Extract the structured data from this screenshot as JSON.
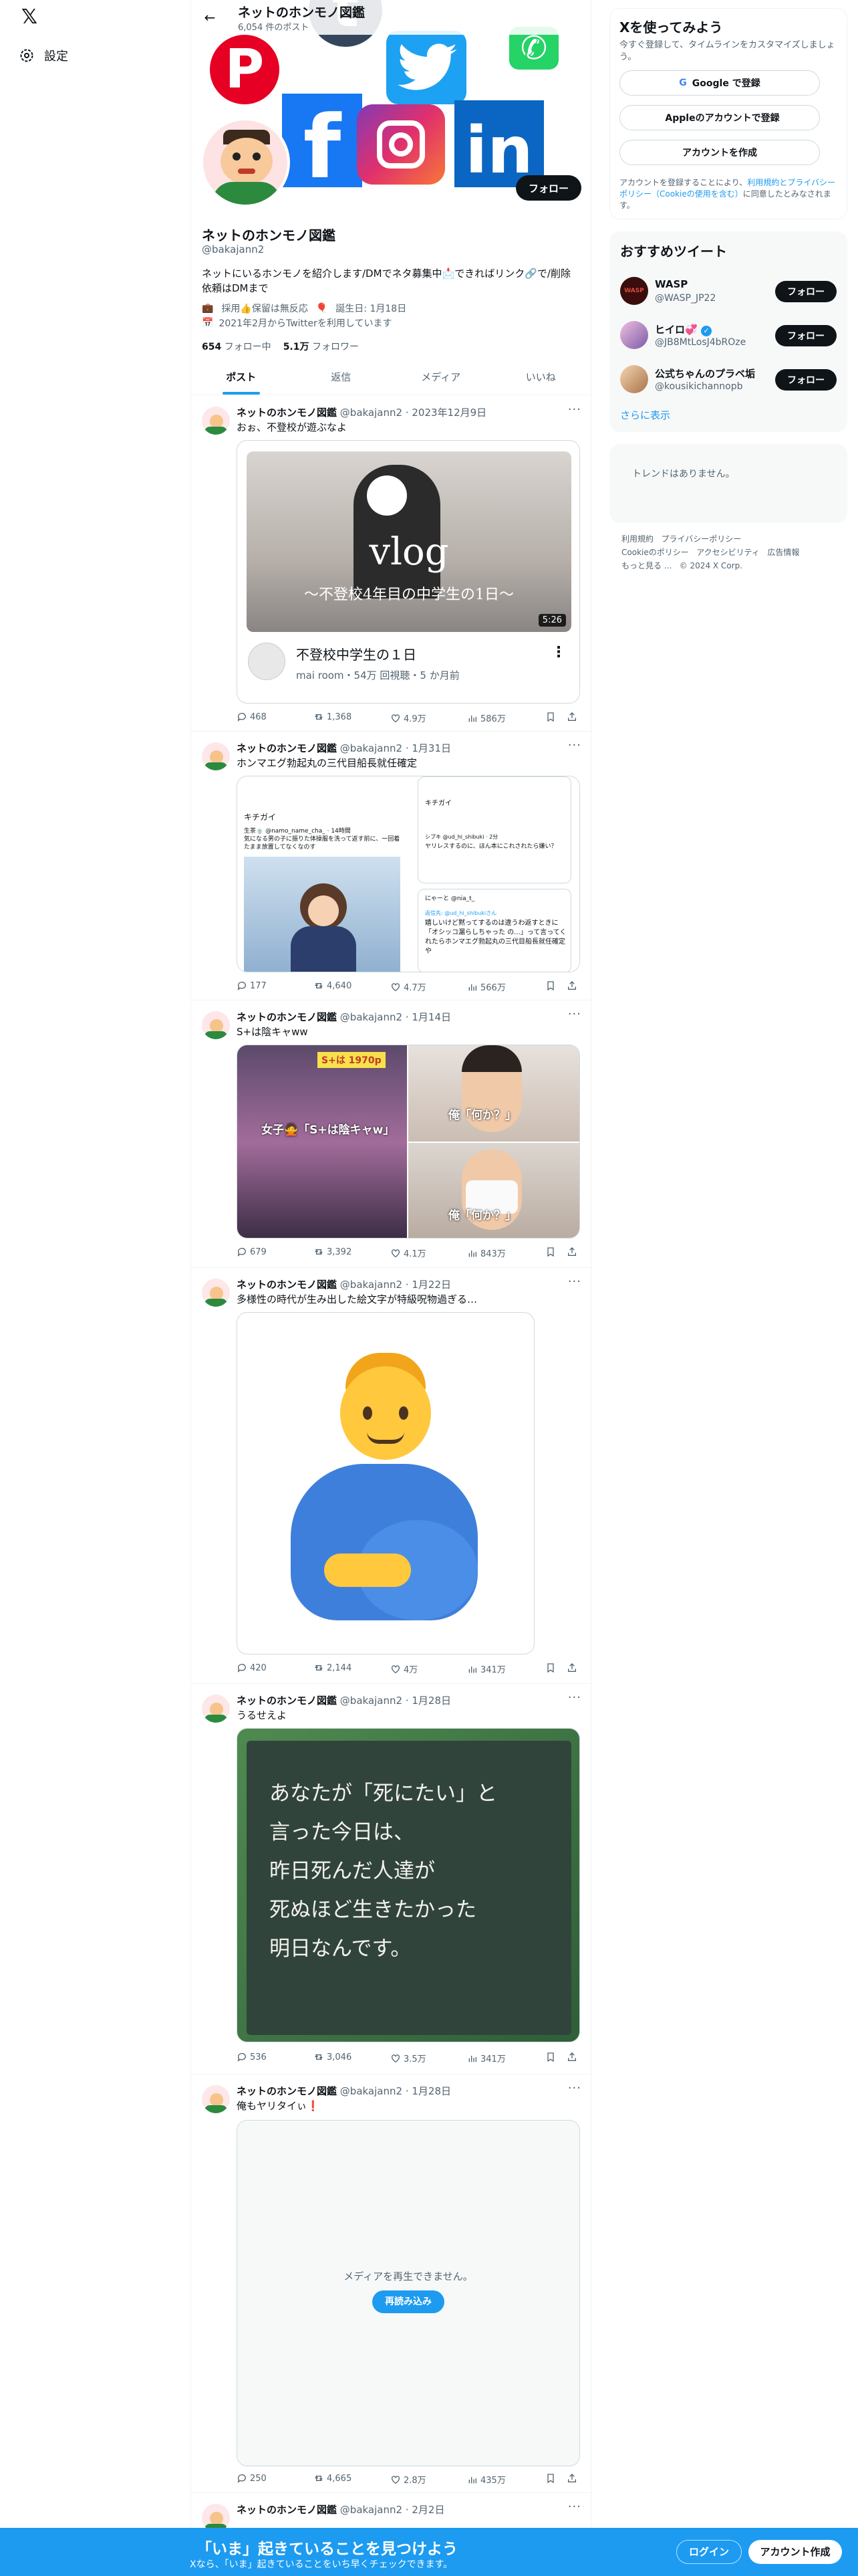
{
  "nav": {
    "settings_label": "設定"
  },
  "header": {
    "title": "ネットのホンモノ図鑑",
    "post_count": "6,054 件のポスト"
  },
  "profile": {
    "name": "ネットのホンモノ図鑑",
    "handle": "@bakajann2",
    "follow_label": "フォロー",
    "bio": "ネットにいるホンモノを紹介します/DMでネタ募集中📩できればリンク🔗で/削除依頼はDMまで",
    "meta_work": "採用👍保留は無反応",
    "meta_birthday": "誕生日: 1月18日",
    "meta_joined": "2021年2月からTwitterを利用しています",
    "following_count": "654",
    "following_label": "フォロー中",
    "followers_count": "5.1万",
    "followers_label": "フォロワー"
  },
  "tabs": [
    {
      "label": "ポスト",
      "active": true
    },
    {
      "label": "返信",
      "active": false
    },
    {
      "label": "メディア",
      "active": false
    },
    {
      "label": "いいね",
      "active": false
    }
  ],
  "tweets": [
    {
      "name": "ネットのホンモノ図鑑",
      "handle": "@bakajann2",
      "date": "2023年12月9日",
      "text": "おぉ、不登校が遊ぶなよ",
      "replies": "468",
      "retweets": "1,368",
      "likes": "4.9万",
      "views": "586万",
      "video": {
        "thumb_title": "vlog",
        "thumb_sub": "〜不登校4年目の中学生の1日〜",
        "duration": "5:26",
        "title": "不登校中学生の１日",
        "meta": "mai room・54万 回視聴・5 か月前"
      }
    },
    {
      "name": "ネットのホンモノ図鑑",
      "handle": "@bakajann2",
      "date": "1月31日",
      "text": "ホンマエグ勃起丸の三代目船長就任確定",
      "replies": "177",
      "retweets": "4,640",
      "likes": "4.7万",
      "views": "566万",
      "shots": {
        "left_user": "生茶🍵 @namo_name_cha_ · 14時間",
        "left_body": "気になる男の子に振りた体操服を洗って返す前に、一回着たまま放置してなくなのす",
        "left_caption": "キチガイ",
        "right_user": "シブキ @ud_hi_shibuki · 2分",
        "right_body": "ヤリレスするのに、ほん本にこれされたら嫌い？",
        "right_caption": "キチガイ",
        "reply_user": "にゃーと @nia_t_",
        "reply_to": "返信先: @ud_hi_shibukiさん",
        "reply_body": "嬉しいけど黙ってするのは違うわ返すときに「オシッコ漏らしちゃった の...」って言ってくれたらホンマエグ勃起丸の三代目船長就任確定や"
      }
    },
    {
      "name": "ネットのホンモノ図鑑",
      "handle": "@bakajann2",
      "date": "1月14日",
      "text": "S+は陰キャww",
      "replies": "679",
      "retweets": "3,392",
      "likes": "4.1万",
      "views": "843万",
      "grid": {
        "left_sign": "S+は 1970p",
        "left_caption": "女子🙅「S+は陰キャw」",
        "tr_caption": "俺「何か？」",
        "br_caption": "俺「何か？」"
      }
    },
    {
      "name": "ネットのホンモノ図鑑",
      "handle": "@bakajann2",
      "date": "1月22日",
      "text": "多様性の時代が生み出した絵文字が特級呪物過ぎる…",
      "replies": "420",
      "retweets": "2,144",
      "likes": "4万",
      "views": "341万"
    },
    {
      "name": "ネットのホンモノ図鑑",
      "handle": "@bakajann2",
      "date": "1月28日",
      "text": "うるせえよ",
      "replies": "536",
      "retweets": "3,046",
      "likes": "3.5万",
      "views": "341万",
      "board": [
        "あなたが「死にたい」と",
        "言った今日は、",
        "昨日死んだ人達が",
        "死ぬほど生きたかった",
        "明日なんです。"
      ]
    },
    {
      "name": "ネットのホンモノ図鑑",
      "handle": "@bakajann2",
      "date": "1月28日",
      "text": "俺もヤリタイぃ❗",
      "replies": "250",
      "retweets": "4,665",
      "likes": "2.8万",
      "views": "435万",
      "error": {
        "message": "メディアを再生できません。",
        "reload": "再読み込み"
      }
    },
    {
      "name": "ネットのホンモノ図鑑",
      "handle": "@bakajann2",
      "date": "2月2日",
      "text": ""
    }
  ],
  "signup": {
    "title": "Xを使ってみよう",
    "subtitle": "今すぐ登録して、タイムラインをカスタマイズしましょう。",
    "google": "Google で登録",
    "apple": "Appleのアカウントで登録",
    "create": "アカウントを作成",
    "terms_prefix": "アカウントを登録することにより、",
    "terms_link": "利用規約とプライバシーポリシー（Cookieの使用を含む）",
    "terms_suffix": "に同意したとみなされます。"
  },
  "recommend": {
    "title": "おすすめツイート",
    "follow_label": "フォロー",
    "more": "さらに表示",
    "users": [
      {
        "name": "WASP",
        "handle": "@WASP_JP22",
        "avatar_text": "WASP"
      },
      {
        "name": "ヒイロ💞",
        "handle": "@JB8MtLosJ4bROze",
        "avatar_text": ""
      },
      {
        "name": "公式ちゃんのプラベ垢",
        "handle": "@kousikichannopb",
        "avatar_text": ""
      }
    ]
  },
  "trends": {
    "empty": "トレンドはありません。"
  },
  "footer": {
    "links": [
      "利用規約",
      "プライバシーポリシー",
      "Cookieのポリシー",
      "アクセシビリティ",
      "広告情報",
      "もっと見る ..."
    ],
    "copyright": "© 2024 X Corp."
  },
  "banner": {
    "title": "「いま」起きていることを見つけよう",
    "subtitle": "Xなら、「いま」起きていることをいち早くチェックできます。",
    "login": "ログイン",
    "signup": "アカウント作成"
  },
  "colors": {
    "accent": "#1d9bf0",
    "text": "#0f1419",
    "muted": "#536471"
  }
}
